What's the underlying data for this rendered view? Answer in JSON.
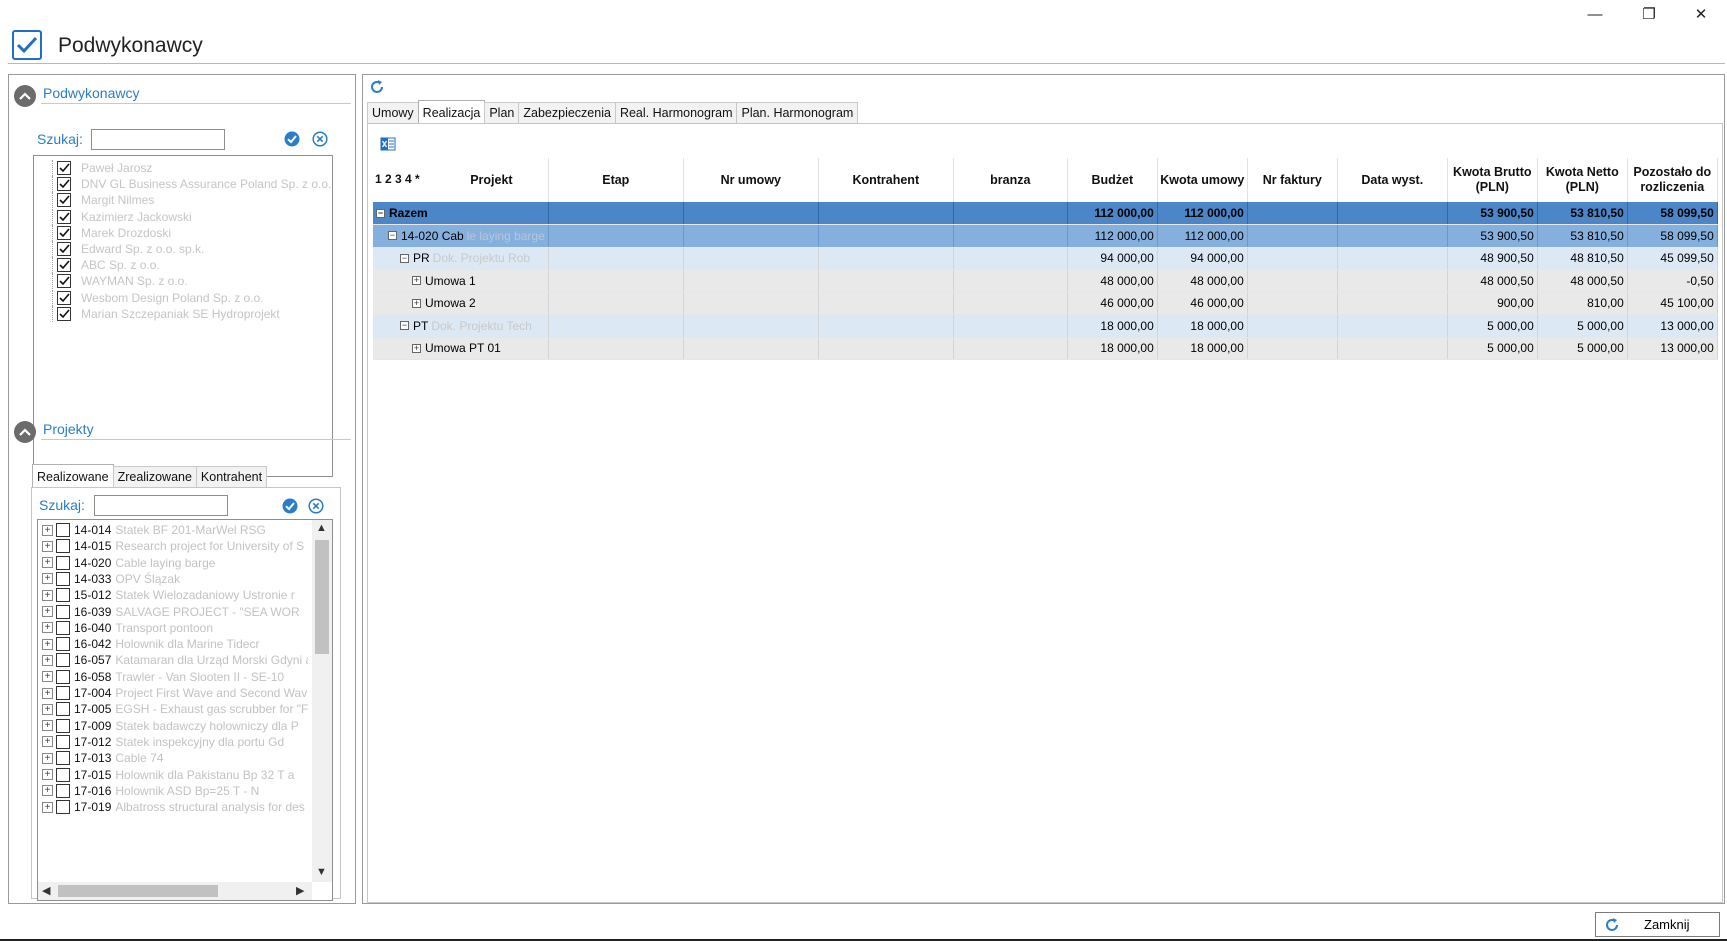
{
  "window": {
    "title": "Podwykonawcy",
    "minimize_symbol": "—",
    "restore_symbol": "❐",
    "close_symbol": "✕"
  },
  "left": {
    "subcontractors": {
      "title": "Podwykonawcy",
      "search_label": "Szukaj:",
      "search_value": "",
      "items": [
        "Paweł Jarosz",
        "DNV GL Business Assurance Poland Sp. z o.o.",
        "Margit Nilmes",
        "Kazimierz Jackowski",
        "Marek Drozdoski",
        "Edward Sp. z o.o. sp.k.",
        "ABC Sp. z o.o.",
        "WAYMAN Sp. z o.o.",
        "Wesbom Design Poland Sp. z o.o.",
        "Marian Szczepaniak SE Hydroprojekt"
      ]
    },
    "projects": {
      "title": "Projekty",
      "tabs": [
        "Realizowane",
        "Zrealizowane",
        "Kontrahent"
      ],
      "search_label": "Szukaj:",
      "search_value": "",
      "items": [
        {
          "code": "14-014",
          "name": "Statek BF 201-MarWel RSG"
        },
        {
          "code": "14-015",
          "name": "Research project for University of S"
        },
        {
          "code": "14-020",
          "name": "Cable laying barge"
        },
        {
          "code": "14-033",
          "name": "OPV Ślązak"
        },
        {
          "code": "15-012",
          "name": "Statek Wielozadaniowy Ustronie r"
        },
        {
          "code": "16-039",
          "name": "SALVAGE PROJECT - \"SEA WOR"
        },
        {
          "code": "16-040",
          "name": "Transport pontoon"
        },
        {
          "code": "16-042",
          "name": "Holownik dla Marine Tidecr"
        },
        {
          "code": "16-057",
          "name": "Katamaran dla Urząd Morski Gdyni a"
        },
        {
          "code": "16-058",
          "name": "Trawler - Van Slooten II - SE-10"
        },
        {
          "code": "17-004",
          "name": "Project First Wave and Second Wav"
        },
        {
          "code": "17-005",
          "name": "EGSH - Exhaust gas scrubber for \"Fin"
        },
        {
          "code": "17-009",
          "name": "Statek badawczy holowniczy dla P"
        },
        {
          "code": "17-012",
          "name": "Statek inspekcyjny dla portu Gd"
        },
        {
          "code": "17-013",
          "name": "Cable 74"
        },
        {
          "code": "17-015",
          "name": "Holownik dla Pakistanu Bp 32 T a"
        },
        {
          "code": "17-016",
          "name": "Holownik ASD Bp=25 T - N"
        },
        {
          "code": "17-019",
          "name": "Albatross structural analysis for des"
        }
      ]
    }
  },
  "right": {
    "refresh_icon": "refresh-icon",
    "excel_icon": "excel-export-icon",
    "tabs": [
      "Umowy",
      "Realizacja",
      "Plan",
      "Zabezpieczenia",
      "Real. Harmonogram",
      "Plan. Harmonogram"
    ],
    "active_tab": "Realizacja",
    "grid": {
      "levels_label": "1 2 3 4 *",
      "headers": [
        "Projekt",
        "Etap",
        "Nr umowy",
        "Kontrahent",
        "branza",
        "Budżet",
        "Kwota umowy",
        "Nr faktury",
        "Data wyst.",
        "Kwota Brutto (PLN)",
        "Kwota Netto (PLN)",
        "Pozostało do rozliczenia"
      ],
      "rows": [
        {
          "level": "total",
          "tree": "Razem",
          "ghost": "",
          "budzet": "112 000,00",
          "kwota_umowy": "112 000,00",
          "brutto": "53 900,50",
          "netto": "53 810,50",
          "pozostalo": "58 099,50"
        },
        {
          "level": "l1",
          "tree": "14-020 Cab",
          "ghost": "le laying barge",
          "budzet": "112 000,00",
          "kwota_umowy": "112 000,00",
          "brutto": "53 900,50",
          "netto": "53 810,50",
          "pozostalo": "58 099,50"
        },
        {
          "level": "l2",
          "tree": "PR",
          "ghost": "Dok. Projektu Rob",
          "budzet": "94 000,00",
          "kwota_umowy": "94 000,00",
          "brutto": "48 900,50",
          "netto": "48 810,50",
          "pozostalo": "45 099,50"
        },
        {
          "level": "l3",
          "tree": "Umowa 1",
          "ghost": "",
          "budzet": "48 000,00",
          "kwota_umowy": "48 000,00",
          "brutto": "48 000,50",
          "netto": "48 000,50",
          "pozostalo": "-0,50"
        },
        {
          "level": "l3",
          "tree": "Umowa 2",
          "ghost": "",
          "budzet": "46 000,00",
          "kwota_umowy": "46 000,00",
          "brutto": "900,00",
          "netto": "810,00",
          "pozostalo": "45 100,00"
        },
        {
          "level": "l2",
          "tree": "PT",
          "ghost": "Dok. Projektu Tech",
          "budzet": "18 000,00",
          "kwota_umowy": "18 000,00",
          "brutto": "5 000,00",
          "netto": "5 000,00",
          "pozostalo": "13 000,00"
        },
        {
          "level": "l3",
          "tree": "Umowa PT 01",
          "ghost": "",
          "budzet": "18 000,00",
          "kwota_umowy": "18 000,00",
          "brutto": "5 000,00",
          "netto": "5 000,00",
          "pozostalo": "13 000,00"
        }
      ]
    }
  },
  "footer": {
    "close_label": "Zamknij"
  },
  "colors": {
    "accent": "#2a7dc9",
    "total_row": "#4a86c8",
    "level1_row": "#85b0de",
    "level2_row": "#dde8f5",
    "level3_row": "#e9e9e9"
  }
}
